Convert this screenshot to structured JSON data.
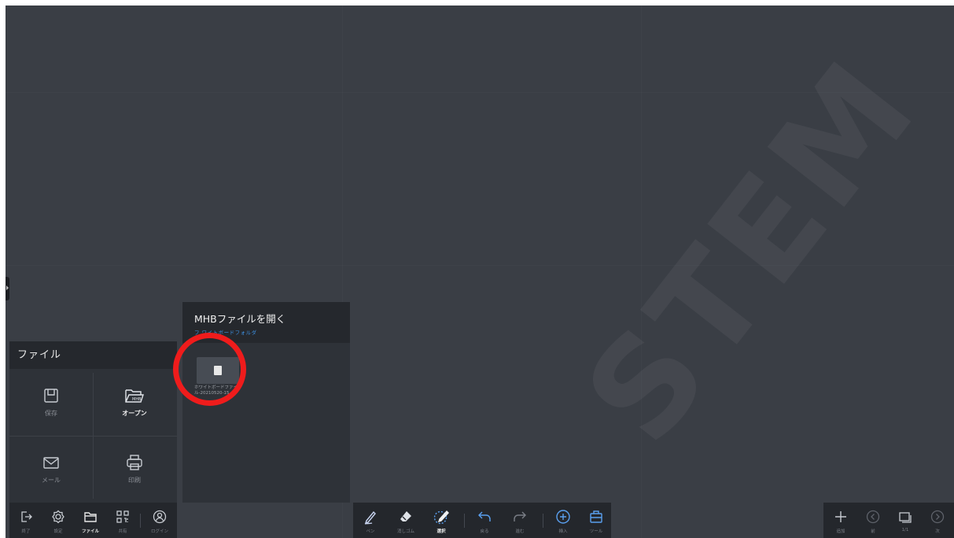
{
  "watermark": "STEM",
  "file_panel": {
    "title": "ファイル",
    "items": [
      {
        "label": "保存",
        "icon": "save-icon",
        "active": false
      },
      {
        "label": "オープン",
        "icon": "folder-open-icon",
        "active": true
      },
      {
        "label": "メール",
        "icon": "mail-icon",
        "active": false
      },
      {
        "label": "印刷",
        "icon": "print-icon",
        "active": false
      }
    ]
  },
  "open_panel": {
    "title": "MHBファイルを開く",
    "path": "フ ワイトボードフォルダ",
    "file": {
      "name": "ホワイトボードファイル-20210520-15..."
    }
  },
  "bottom_left": {
    "items": [
      {
        "label": "終了",
        "icon": "exit-icon"
      },
      {
        "label": "設定",
        "icon": "gear-icon"
      },
      {
        "label": "ファイル",
        "icon": "folder-icon",
        "active": true
      },
      {
        "label": "共有",
        "icon": "qr-code-icon"
      },
      {
        "label": "ログイン",
        "icon": "user-icon"
      }
    ]
  },
  "bottom_center": {
    "items": [
      {
        "label": "ペン",
        "icon": "pen-icon"
      },
      {
        "label": "消しゴム",
        "icon": "eraser-icon"
      },
      {
        "label": "選択",
        "icon": "select-icon",
        "active": true
      },
      {
        "label": "戻る",
        "icon": "undo-icon"
      },
      {
        "label": "進む",
        "icon": "redo-icon"
      },
      {
        "label": "挿入",
        "icon": "insert-icon"
      },
      {
        "label": "ツール",
        "icon": "toolbox-icon"
      }
    ]
  },
  "bottom_right": {
    "items": [
      {
        "label": "追加",
        "icon": "add-icon"
      },
      {
        "label": "前",
        "icon": "prev-icon"
      },
      {
        "label": "1/1",
        "icon": "page-icon"
      },
      {
        "label": "次",
        "icon": "next-icon"
      }
    ]
  }
}
